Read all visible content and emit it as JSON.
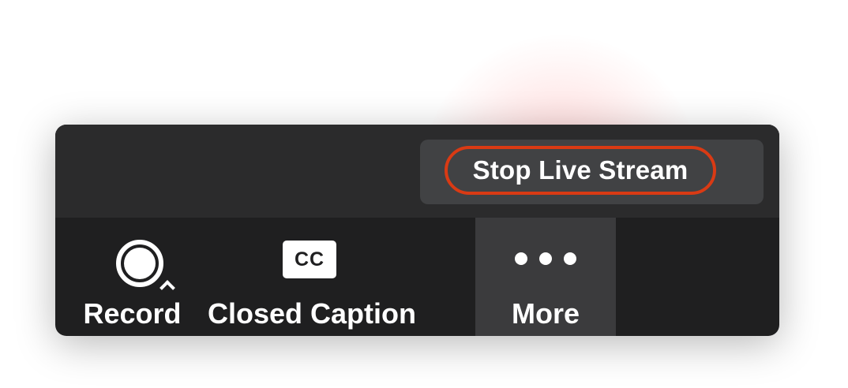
{
  "live_stream": {
    "stop_label": "Stop Live Stream",
    "highlight_color": "#d93a14"
  },
  "toolbar": {
    "record_label": "Record",
    "record_icon": "record-circle-icon",
    "record_menu_icon": "chevron-up-icon",
    "closed_caption_label": "Closed Caption",
    "closed_caption_icon_text": "CC",
    "more_label": "More",
    "more_icon": "ellipsis-icon"
  },
  "colors": {
    "toolbar_background": "#1f1f20",
    "top_bar_background": "#2b2b2c",
    "pill_background": "#414244",
    "more_active_background": "#3b3b3d",
    "text": "#ffffff"
  }
}
